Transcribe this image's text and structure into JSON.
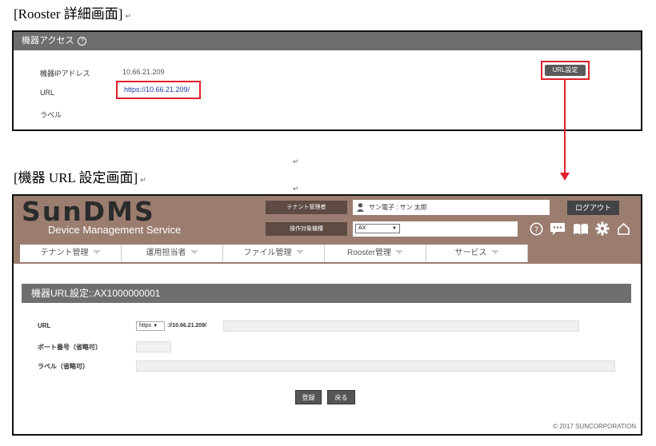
{
  "headings": {
    "detail": "[Rooster 詳細画面]",
    "setting": "[機器 URL 設定画面]"
  },
  "detail_panel": {
    "header_title": "機器アクセス",
    "help_symbol": "?",
    "rows": [
      {
        "label": "機器IPアドレス",
        "value": "10.66.21.209"
      },
      {
        "label": "URL",
        "value": "https://10.66.21.209/"
      },
      {
        "label": "ラベル",
        "value": ""
      }
    ],
    "url_setting_button": "URL設定"
  },
  "app": {
    "logo": "SunDMS",
    "service_name": "Device Management Service",
    "tenant_admin_label": "テナント管理者",
    "tenant_admin_value": "サン電子 : サン 太郎",
    "target_device_label": "操作対象機種",
    "target_device_value": "AX",
    "logout_label": "ログアウト",
    "header_icons": [
      "help-icon",
      "chat-icon",
      "manual-icon",
      "gear-icon",
      "home-icon"
    ],
    "nav_tabs": [
      "テナント管理",
      "運用担当者",
      "ファイル管理",
      "Rooster管理",
      "サービス"
    ],
    "page_title": "機器URL設定::AX1000000001",
    "form": {
      "url_label": "URL",
      "protocol_value": "https",
      "host_text": "://10.66.21.209/",
      "port_label": "ポート番号（省略可）",
      "label_label": "ラベル（省略可）"
    },
    "register_button": "登録",
    "back_button": "戻る",
    "copyright": "© 2017 SUNCORPORATION"
  },
  "colors": {
    "highlight_red": "#e0202a",
    "header_brown": "#9b7d70",
    "panel_gray": "#6d6d6d"
  }
}
